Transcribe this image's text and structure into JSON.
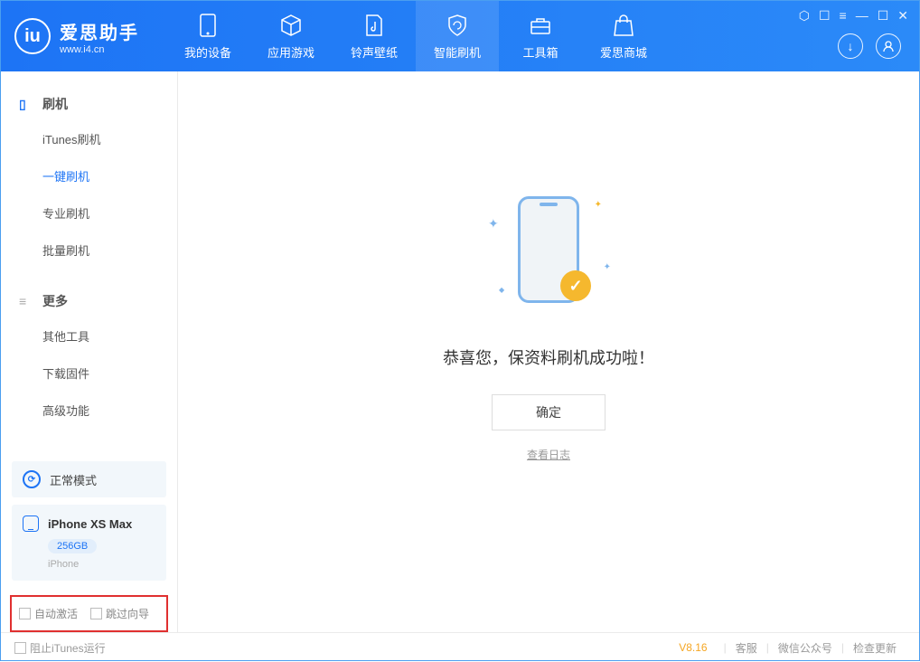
{
  "app": {
    "name": "爱思助手",
    "domain": "www.i4.cn"
  },
  "tabs": {
    "device": "我的设备",
    "apps": "应用游戏",
    "ring": "铃声壁纸",
    "flash": "智能刷机",
    "tools": "工具箱",
    "store": "爱思商城"
  },
  "sidebar": {
    "section1": "刷机",
    "itunes": "iTunes刷机",
    "oneclick": "一键刷机",
    "pro": "专业刷机",
    "batch": "批量刷机",
    "section2": "更多",
    "other": "其他工具",
    "firmware": "下载固件",
    "advanced": "高级功能"
  },
  "mode": {
    "label": "正常模式"
  },
  "device": {
    "name": "iPhone XS Max",
    "storage": "256GB",
    "type": "iPhone"
  },
  "options": {
    "auto_activate": "自动激活",
    "skip_guide": "跳过向导"
  },
  "main": {
    "success": "恭喜您，保资料刷机成功啦！",
    "ok": "确定",
    "log": "查看日志"
  },
  "footer": {
    "stop_itunes": "阻止iTunes运行",
    "version": "V8.16",
    "support": "客服",
    "wechat": "微信公众号",
    "update": "检查更新"
  }
}
